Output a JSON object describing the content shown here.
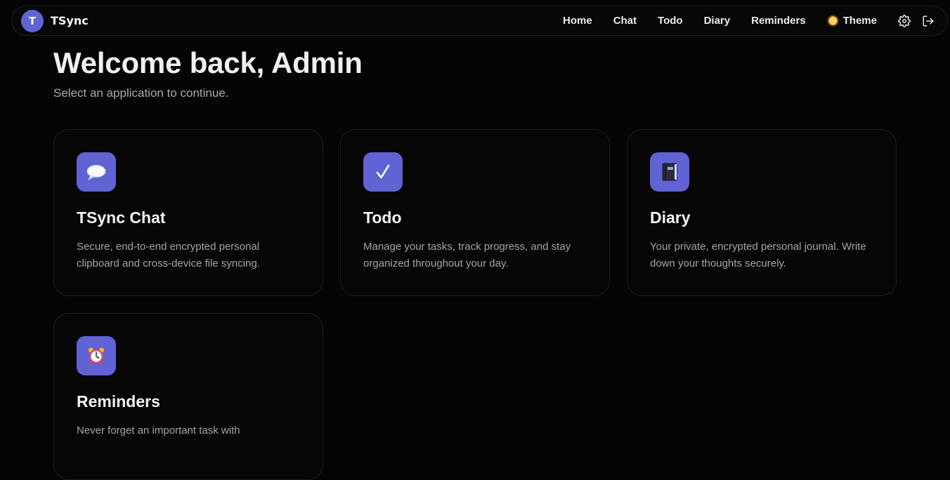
{
  "brand": {
    "initial": "T",
    "name": "TSync",
    "accent_color": "#5f63d3"
  },
  "nav": {
    "links": [
      "Home",
      "Chat",
      "Todo",
      "Diary",
      "Reminders"
    ],
    "theme_label": "Theme",
    "theme_icon": "sun-icon",
    "settings_icon": "gear-icon",
    "logout_icon": "logout-icon"
  },
  "header": {
    "title": "Welcome back, Admin",
    "subtitle": "Select an application to continue."
  },
  "apps": [
    {
      "name": "TSync Chat",
      "description": "Secure, end-to-end encrypted personal clipboard and cross-device file syncing.",
      "icon": "speech-bubble-icon"
    },
    {
      "name": "Todo",
      "description": "Manage your tasks, track progress, and stay organized throughout your day.",
      "icon": "checkmark-icon"
    },
    {
      "name": "Diary",
      "description": "Your private, encrypted personal journal. Write down your thoughts securely.",
      "icon": "notebook-icon"
    },
    {
      "name": "Reminders",
      "description": "Never forget an important task with",
      "icon": "alarm-clock-icon"
    }
  ]
}
